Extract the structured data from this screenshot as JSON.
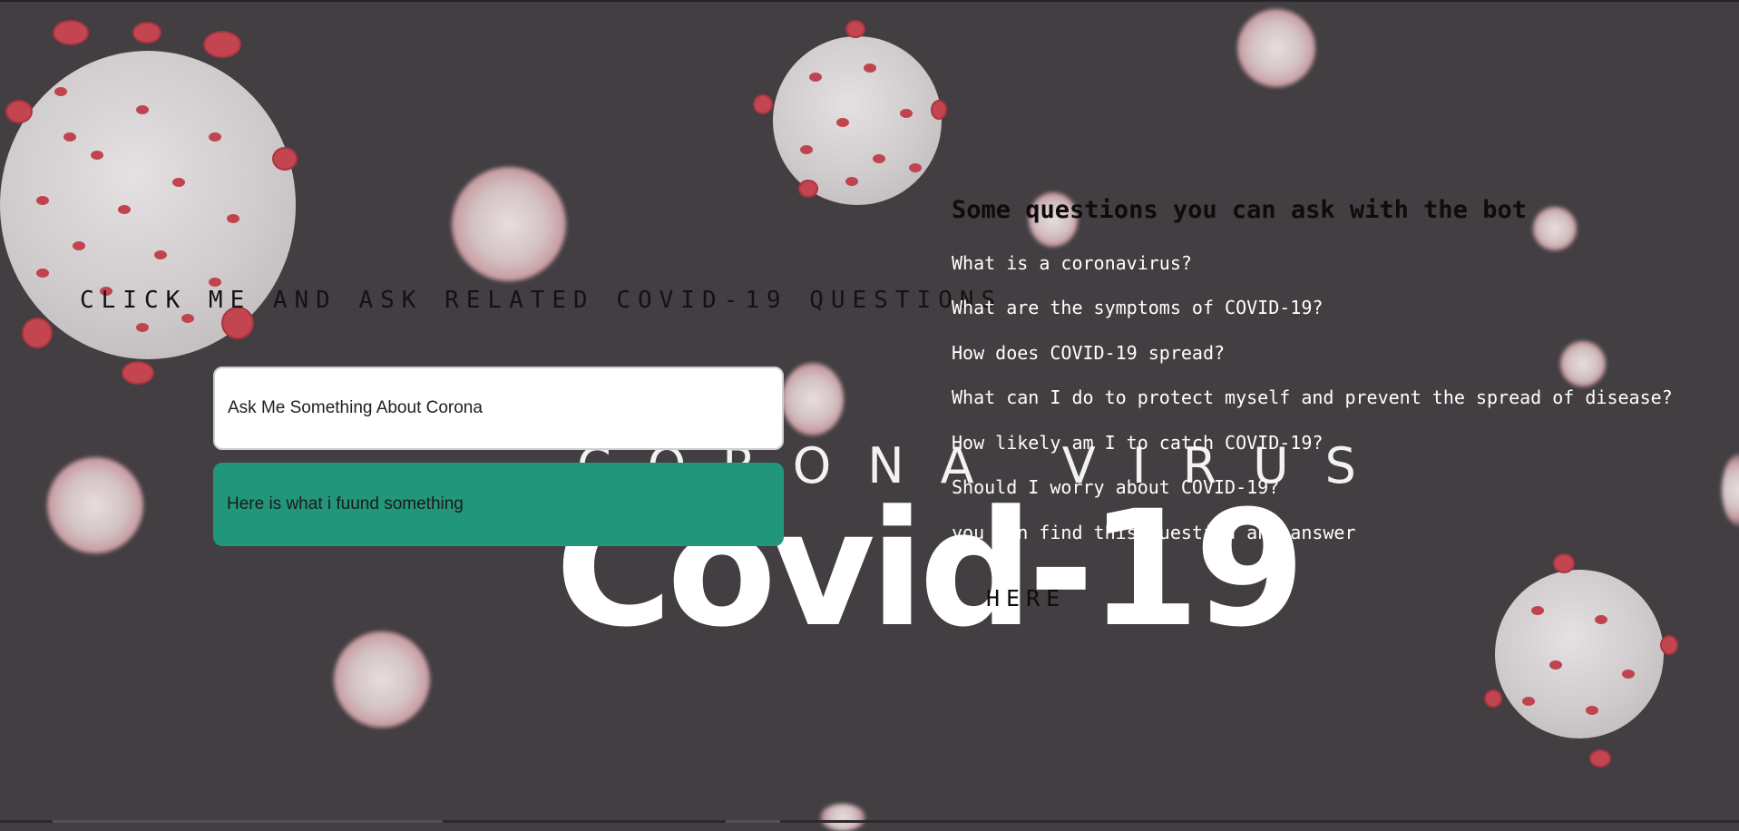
{
  "background": {
    "corona_text": "CORONA VIRUS",
    "covid_text": "Covid-19",
    "color": "#423e42"
  },
  "chatbot": {
    "heading": "CLICK ME AND ASK RELATED COVID-19 QUESTIONS",
    "input_placeholder": "Ask Me Something About Corona",
    "answer": "Here is what i fuund something",
    "answer_color": "#21967a"
  },
  "questions": {
    "title": "Some questions you can ask with the bot",
    "items": [
      "What is a coronavirus?",
      "What are the symptoms of COVID-19?",
      "How does COVID-19 spread?",
      "What can I do to protect myself and prevent the spread of disease?",
      "How likely am I to catch COVID-19?",
      "Should I worry about COVID-19?",
      "you can find this question and answer"
    ],
    "link_label": "HERE"
  }
}
